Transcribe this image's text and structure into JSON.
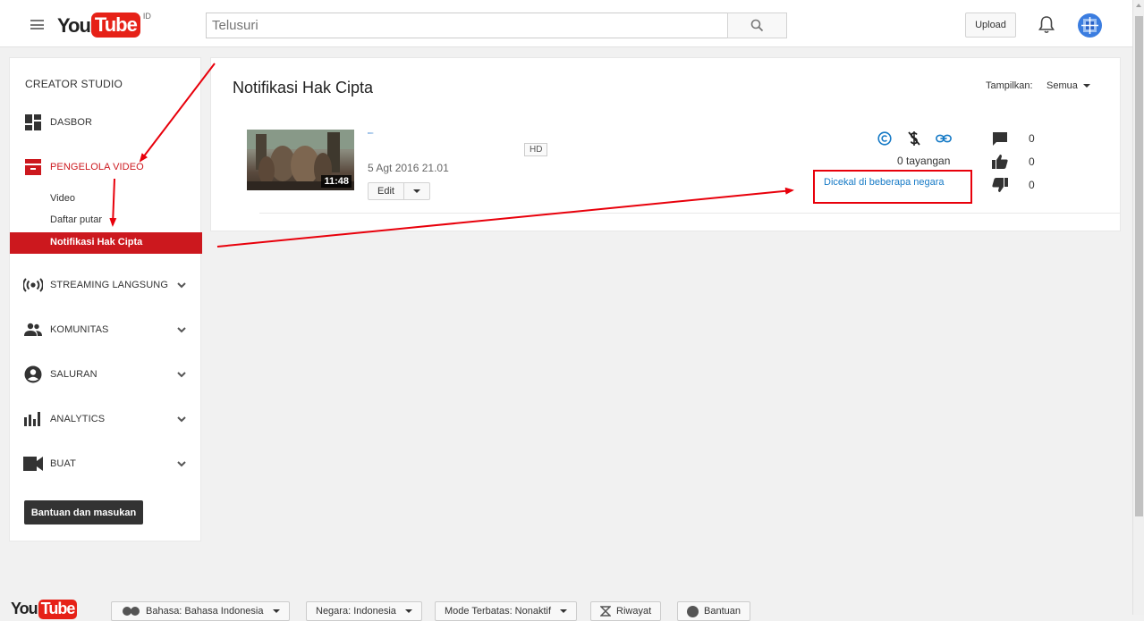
{
  "header": {
    "logo_you": "You",
    "logo_tube": "Tube",
    "country_code": "ID",
    "search_placeholder": "Telusuri",
    "upload_label": "Upload"
  },
  "sidebar": {
    "title": "CREATOR STUDIO",
    "items": [
      {
        "label": "DASBOR",
        "icon": "dashboard-icon"
      },
      {
        "label": "PENGELOLA VIDEO",
        "icon": "video-manager-icon"
      },
      {
        "label": "STREAMING LANGSUNG",
        "icon": "live-streaming-icon"
      },
      {
        "label": "KOMUNITAS",
        "icon": "community-icon"
      },
      {
        "label": "SALURAN",
        "icon": "channel-icon"
      },
      {
        "label": "ANALYTICS",
        "icon": "analytics-icon"
      },
      {
        "label": "BUAT",
        "icon": "create-icon"
      }
    ],
    "subitems": [
      "Video",
      "Daftar putar",
      "Notifikasi Hak Cipta"
    ],
    "help_label": "Bantuan dan masukan"
  },
  "main": {
    "title": "Notifikasi Hak Cipta",
    "filter_label": "Tampilkan:",
    "filter_value": "Semua",
    "video": {
      "duration": "11:48",
      "badge": "HD",
      "date": "5 Agt 2016 21.01",
      "edit_label": "Edit",
      "views": "0 tayangan",
      "status_link": "Dicekal di beberapa negara",
      "comments": "0",
      "likes": "0",
      "dislikes": "0"
    }
  },
  "footer": {
    "logo_you": "You",
    "logo_tube": "Tube",
    "language": "Bahasa: Bahasa Indonesia",
    "country": "Negara: Indonesia",
    "restricted": "Mode Terbatas: Nonaktif",
    "history": "Riwayat",
    "help": "Bantuan"
  },
  "colors": {
    "brand_red": "#e62117",
    "active_red": "#cc181e",
    "link_blue": "#167ac6",
    "annotation_red": "#e8000b"
  }
}
